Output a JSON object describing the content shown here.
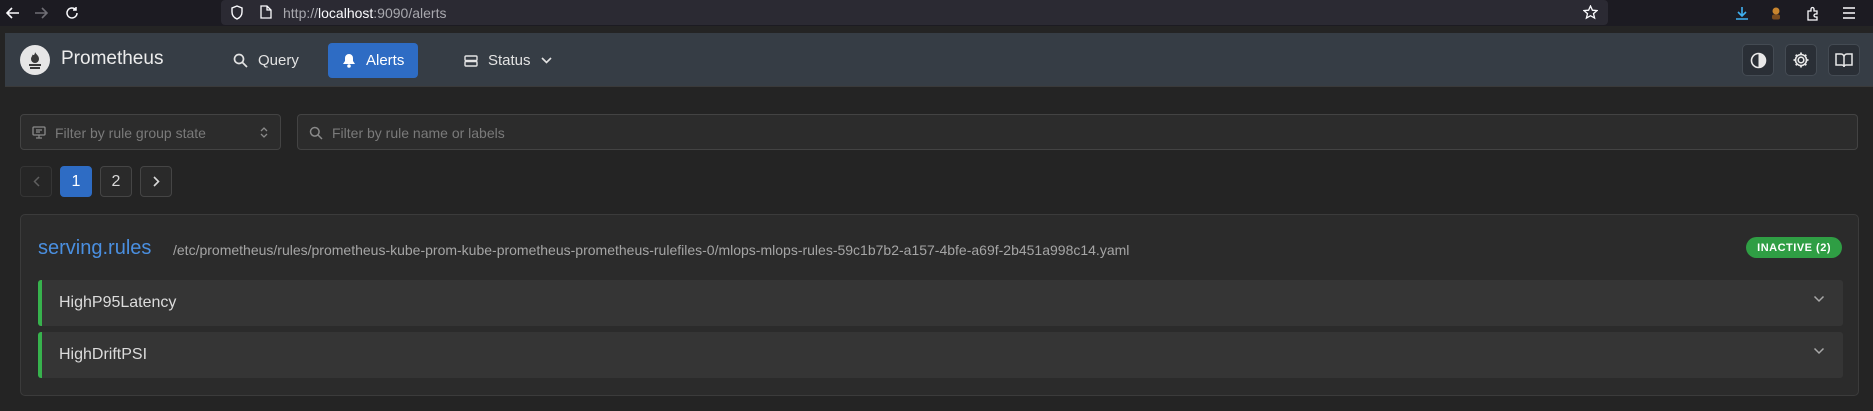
{
  "browser": {
    "url_scheme": "http://",
    "url_host": "localhost",
    "url_rest": ":9090/alerts"
  },
  "header": {
    "brand": "Prometheus",
    "nav": [
      {
        "label": "Query",
        "icon": "search-icon",
        "active": false
      },
      {
        "label": "Alerts",
        "icon": "bell-icon",
        "active": true
      },
      {
        "label": "Status",
        "icon": "server-icon",
        "active": false
      }
    ],
    "accent_color": "#2e6cc4"
  },
  "filters": {
    "state_placeholder": "Filter by rule group state",
    "search_placeholder": "Filter by rule name or labels"
  },
  "pagination": {
    "pages": [
      "1",
      "2"
    ],
    "current": "1"
  },
  "rule_group": {
    "name": "serving.rules",
    "file": "/etc/prometheus/rules/prometheus-kube-prom-kube-prometheus-prometheus-rulefiles-0/mlops-mlops-rules-59c1b7b2-a157-4bfe-a69f-2b451a998c14.yaml",
    "badge": "INACTIVE (2)",
    "badge_color": "#2f9e44",
    "rules": [
      {
        "name": "HighP95Latency"
      },
      {
        "name": "HighDriftPSI"
      }
    ]
  }
}
